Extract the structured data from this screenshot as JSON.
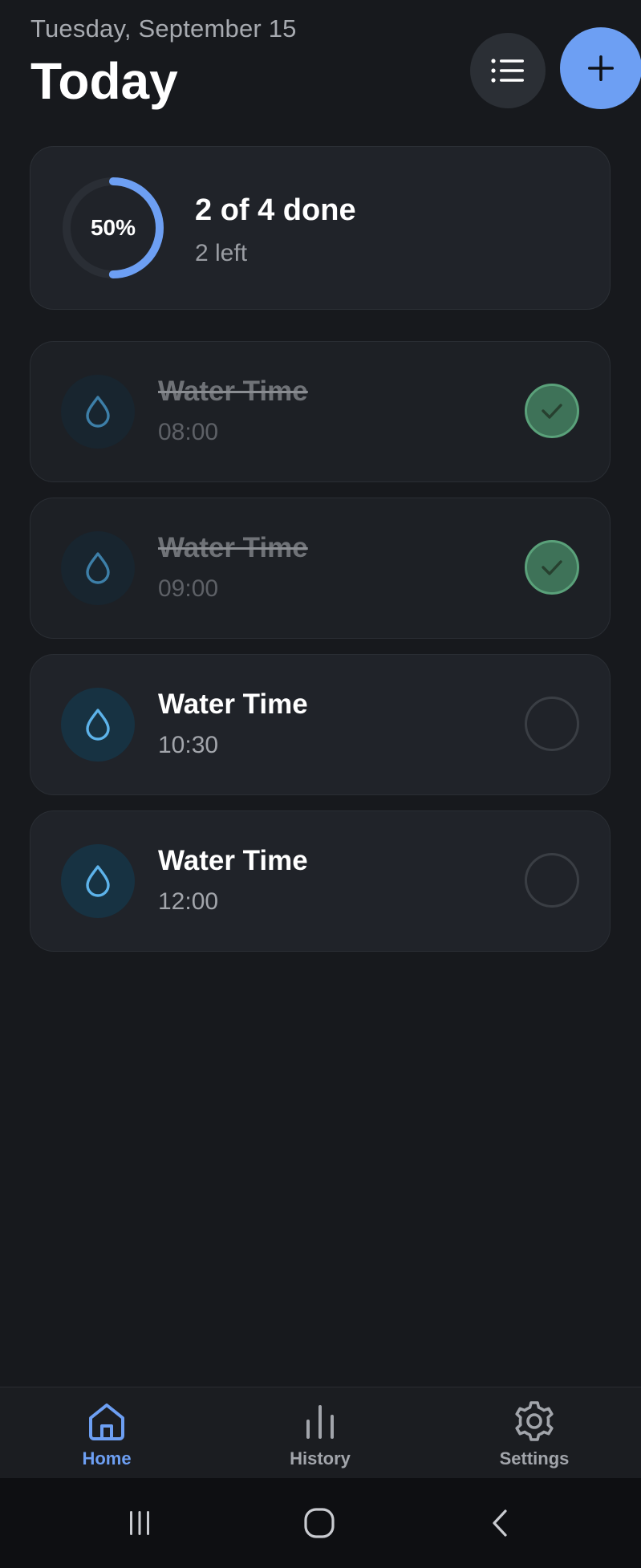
{
  "header": {
    "date": "Tuesday, September 15",
    "title": "Today"
  },
  "summary": {
    "percent_label": "50%",
    "progress": 0.5,
    "done_text": "2 of 4 done",
    "left_text": "2 left"
  },
  "tasks": [
    {
      "title": "Water Time",
      "time": "08:00",
      "done": true
    },
    {
      "title": "Water Time",
      "time": "09:00",
      "done": true
    },
    {
      "title": "Water Time",
      "time": "10:30",
      "done": false
    },
    {
      "title": "Water Time",
      "time": "12:00",
      "done": false
    }
  ],
  "bottom_nav": [
    {
      "label": "Home",
      "icon": "home-icon",
      "active": true
    },
    {
      "label": "History",
      "icon": "bar-chart-icon",
      "active": false
    },
    {
      "label": "Settings",
      "icon": "gear-icon",
      "active": false
    }
  ],
  "colors": {
    "accent": "#6d9ff3",
    "done_green": "#3e7258",
    "background": "#17191d",
    "card": "#202329"
  },
  "icons": {
    "list": "list-icon",
    "add": "plus-icon",
    "drop": "water-drop-icon",
    "check": "check-icon"
  }
}
